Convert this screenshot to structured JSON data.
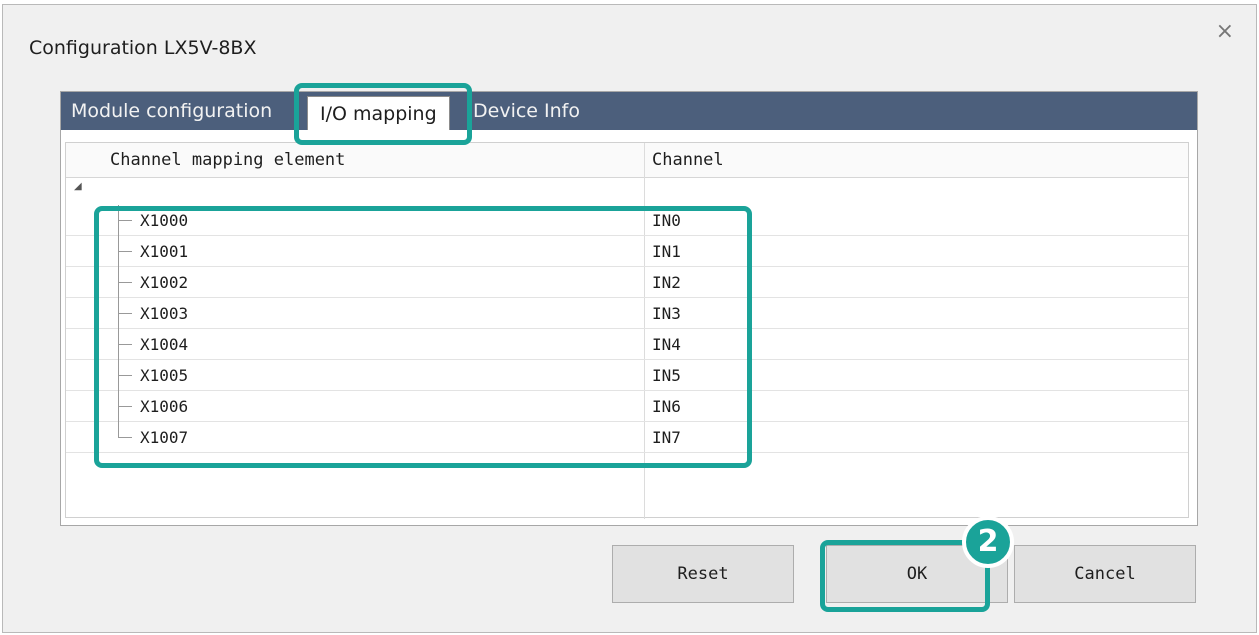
{
  "dialog": {
    "title": "Configuration LX5V-8BX",
    "close_glyph": "×"
  },
  "tabs": [
    {
      "label": "Module configuration",
      "selected": false
    },
    {
      "label": "I/O mapping",
      "selected": true
    },
    {
      "label": "Device Info",
      "selected": false
    }
  ],
  "grid": {
    "headers": {
      "element": "Channel mapping element",
      "channel": "Channel"
    },
    "tree_toggle": "◢",
    "rows": [
      {
        "element": "X1000",
        "channel": "IN0"
      },
      {
        "element": "X1001",
        "channel": "IN1"
      },
      {
        "element": "X1002",
        "channel": "IN2"
      },
      {
        "element": "X1003",
        "channel": "IN3"
      },
      {
        "element": "X1004",
        "channel": "IN4"
      },
      {
        "element": "X1005",
        "channel": "IN5"
      },
      {
        "element": "X1006",
        "channel": "IN6"
      },
      {
        "element": "X1007",
        "channel": "IN7"
      }
    ]
  },
  "buttons": {
    "reset": "Reset",
    "ok": "OK",
    "cancel": "Cancel"
  },
  "annotations": {
    "step_number": "2",
    "highlight_color": "#1aa399"
  },
  "colors": {
    "tab_strip": "#4c5f7c",
    "dialog_bg": "#f0f0f0"
  }
}
